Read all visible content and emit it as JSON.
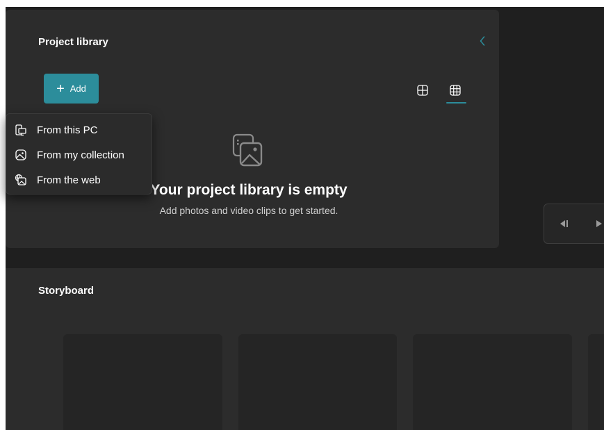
{
  "project_library": {
    "title": "Project library",
    "add_label": "Add",
    "empty_title": "Your project library is empty",
    "empty_subtitle": "Add photos and video clips to get started."
  },
  "add_menu": {
    "items": [
      {
        "label": "From this PC",
        "icon": "computer-icon"
      },
      {
        "label": "From my collection",
        "icon": "image-collection-icon"
      },
      {
        "label": "From the web",
        "icon": "web-image-icon"
      }
    ]
  },
  "storyboard": {
    "title": "Storyboard"
  },
  "colors": {
    "accent": "#2c8d9b",
    "panel": "#2c2c2c",
    "background": "#1f1f1f"
  }
}
